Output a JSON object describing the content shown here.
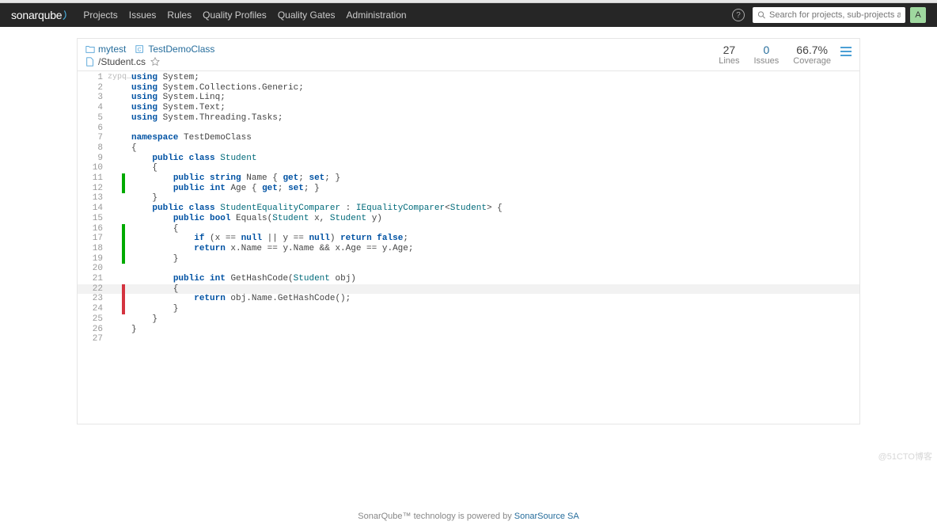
{
  "header": {
    "brand": "sonarqube",
    "nav": [
      "Projects",
      "Issues",
      "Rules",
      "Quality Profiles",
      "Quality Gates",
      "Administration"
    ],
    "search_placeholder": "Search for projects, sub-projects and files...",
    "avatar_letter": "A"
  },
  "breadcrumbs": {
    "project": "mytest",
    "class": "TestDemoClass",
    "file": "/Student.cs"
  },
  "metrics": {
    "lines": {
      "value": "27",
      "label": "Lines"
    },
    "issues": {
      "value": "0",
      "label": "Issues"
    },
    "coverage": {
      "value": "66.7%",
      "label": "Coverage"
    }
  },
  "code": {
    "lines": [
      {
        "n": 1,
        "gutter": "zypq…",
        "cov": "",
        "hl": false,
        "html": "<span class='kw'>using</span> System;"
      },
      {
        "n": 2,
        "gutter": "",
        "cov": "",
        "hl": false,
        "html": "<span class='kw'>using</span> System.Collections.Generic;"
      },
      {
        "n": 3,
        "gutter": "",
        "cov": "",
        "hl": false,
        "html": "<span class='kw'>using</span> System.Linq;"
      },
      {
        "n": 4,
        "gutter": "",
        "cov": "",
        "hl": false,
        "html": "<span class='kw'>using</span> System.Text;"
      },
      {
        "n": 5,
        "gutter": "",
        "cov": "",
        "hl": false,
        "html": "<span class='kw'>using</span> System.Threading.Tasks;"
      },
      {
        "n": 6,
        "gutter": "",
        "cov": "",
        "hl": false,
        "html": ""
      },
      {
        "n": 7,
        "gutter": "",
        "cov": "",
        "hl": false,
        "html": "<span class='kw'>namespace</span> TestDemoClass"
      },
      {
        "n": 8,
        "gutter": "",
        "cov": "",
        "hl": false,
        "html": "{"
      },
      {
        "n": 9,
        "gutter": "",
        "cov": "",
        "hl": false,
        "html": "    <span class='kw'>public</span> <span class='kw'>class</span> <span class='tp'>Student</span>"
      },
      {
        "n": 10,
        "gutter": "",
        "cov": "",
        "hl": false,
        "html": "    {"
      },
      {
        "n": 11,
        "gutter": "",
        "cov": "g",
        "hl": false,
        "html": "        <span class='kw'>public</span> <span class='kw'>string</span> Name { <span class='kw'>get</span>; <span class='kw'>set</span>; }"
      },
      {
        "n": 12,
        "gutter": "",
        "cov": "g",
        "hl": false,
        "html": "        <span class='kw'>public</span> <span class='kw'>int</span> Age { <span class='kw'>get</span>; <span class='kw'>set</span>; }"
      },
      {
        "n": 13,
        "gutter": "",
        "cov": "",
        "hl": false,
        "html": "    }"
      },
      {
        "n": 14,
        "gutter": "",
        "cov": "",
        "hl": false,
        "html": "    <span class='kw'>public</span> <span class='kw'>class</span> <span class='tp'>StudentEqualityComparer</span> : <span class='tp'>IEqualityComparer</span>&lt;<span class='tp'>Student</span>&gt; {"
      },
      {
        "n": 15,
        "gutter": "",
        "cov": "",
        "hl": false,
        "html": "        <span class='kw'>public</span> <span class='kw'>bool</span> Equals(<span class='tp'>Student</span> x, <span class='tp'>Student</span> y)"
      },
      {
        "n": 16,
        "gutter": "",
        "cov": "g",
        "hl": false,
        "html": "        {"
      },
      {
        "n": 17,
        "gutter": "",
        "cov": "g",
        "hl": false,
        "html": "            <span class='kw'>if</span> (x == <span class='kw'>null</span> || y == <span class='kw'>null</span>) <span class='kw'>return</span> <span class='kw'>false</span>;"
      },
      {
        "n": 18,
        "gutter": "",
        "cov": "g",
        "hl": false,
        "html": "            <span class='kw'>return</span> x.Name == y.Name && x.Age == y.Age;"
      },
      {
        "n": 19,
        "gutter": "",
        "cov": "g",
        "hl": false,
        "html": "        }"
      },
      {
        "n": 20,
        "gutter": "",
        "cov": "",
        "hl": false,
        "html": ""
      },
      {
        "n": 21,
        "gutter": "",
        "cov": "",
        "hl": false,
        "html": "        <span class='kw'>public</span> <span class='kw'>int</span> GetHashCode(<span class='tp'>Student</span> obj)"
      },
      {
        "n": 22,
        "gutter": "",
        "cov": "r",
        "hl": true,
        "html": "        {"
      },
      {
        "n": 23,
        "gutter": "",
        "cov": "r",
        "hl": false,
        "html": "            <span class='kw'>return</span> obj.Name.GetHashCode();"
      },
      {
        "n": 24,
        "gutter": "",
        "cov": "r",
        "hl": false,
        "html": "        }"
      },
      {
        "n": 25,
        "gutter": "",
        "cov": "",
        "hl": false,
        "html": "    }"
      },
      {
        "n": 26,
        "gutter": "",
        "cov": "",
        "hl": false,
        "html": "}"
      },
      {
        "n": 27,
        "gutter": "",
        "cov": "",
        "hl": false,
        "html": ""
      }
    ]
  },
  "footer": {
    "prefix": "SonarQube™ technology is powered by ",
    "link": "SonarSource SA"
  },
  "watermark": "@51CTO博客"
}
